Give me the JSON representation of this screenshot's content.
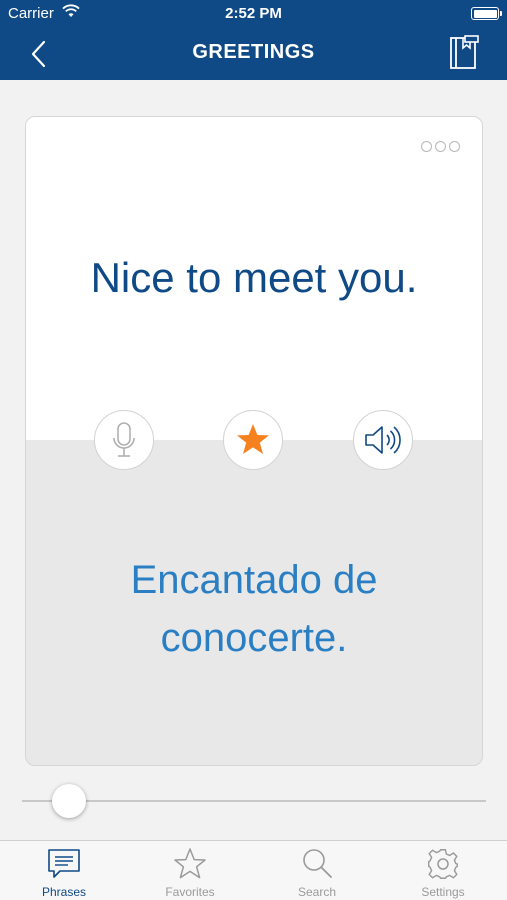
{
  "status_bar": {
    "carrier": "Carrier",
    "time": "2:52 PM"
  },
  "nav": {
    "title": "GREETINGS"
  },
  "card": {
    "phrase": "Nice to meet you.",
    "translation": "Encantado de conocerte.",
    "favorite_color": "#f5821f"
  },
  "slider": {
    "position": 0.04
  },
  "tabs": [
    {
      "label": "Phrases",
      "icon": "chat-bubble-icon",
      "active": true
    },
    {
      "label": "Favorites",
      "icon": "star-outline-icon",
      "active": false
    },
    {
      "label": "Search",
      "icon": "search-icon",
      "active": false
    },
    {
      "label": "Settings",
      "icon": "gear-icon",
      "active": false
    }
  ],
  "colors": {
    "brand": "#0f4a86",
    "translation": "#2a7fc4",
    "inactive": "#9a9a9a"
  }
}
